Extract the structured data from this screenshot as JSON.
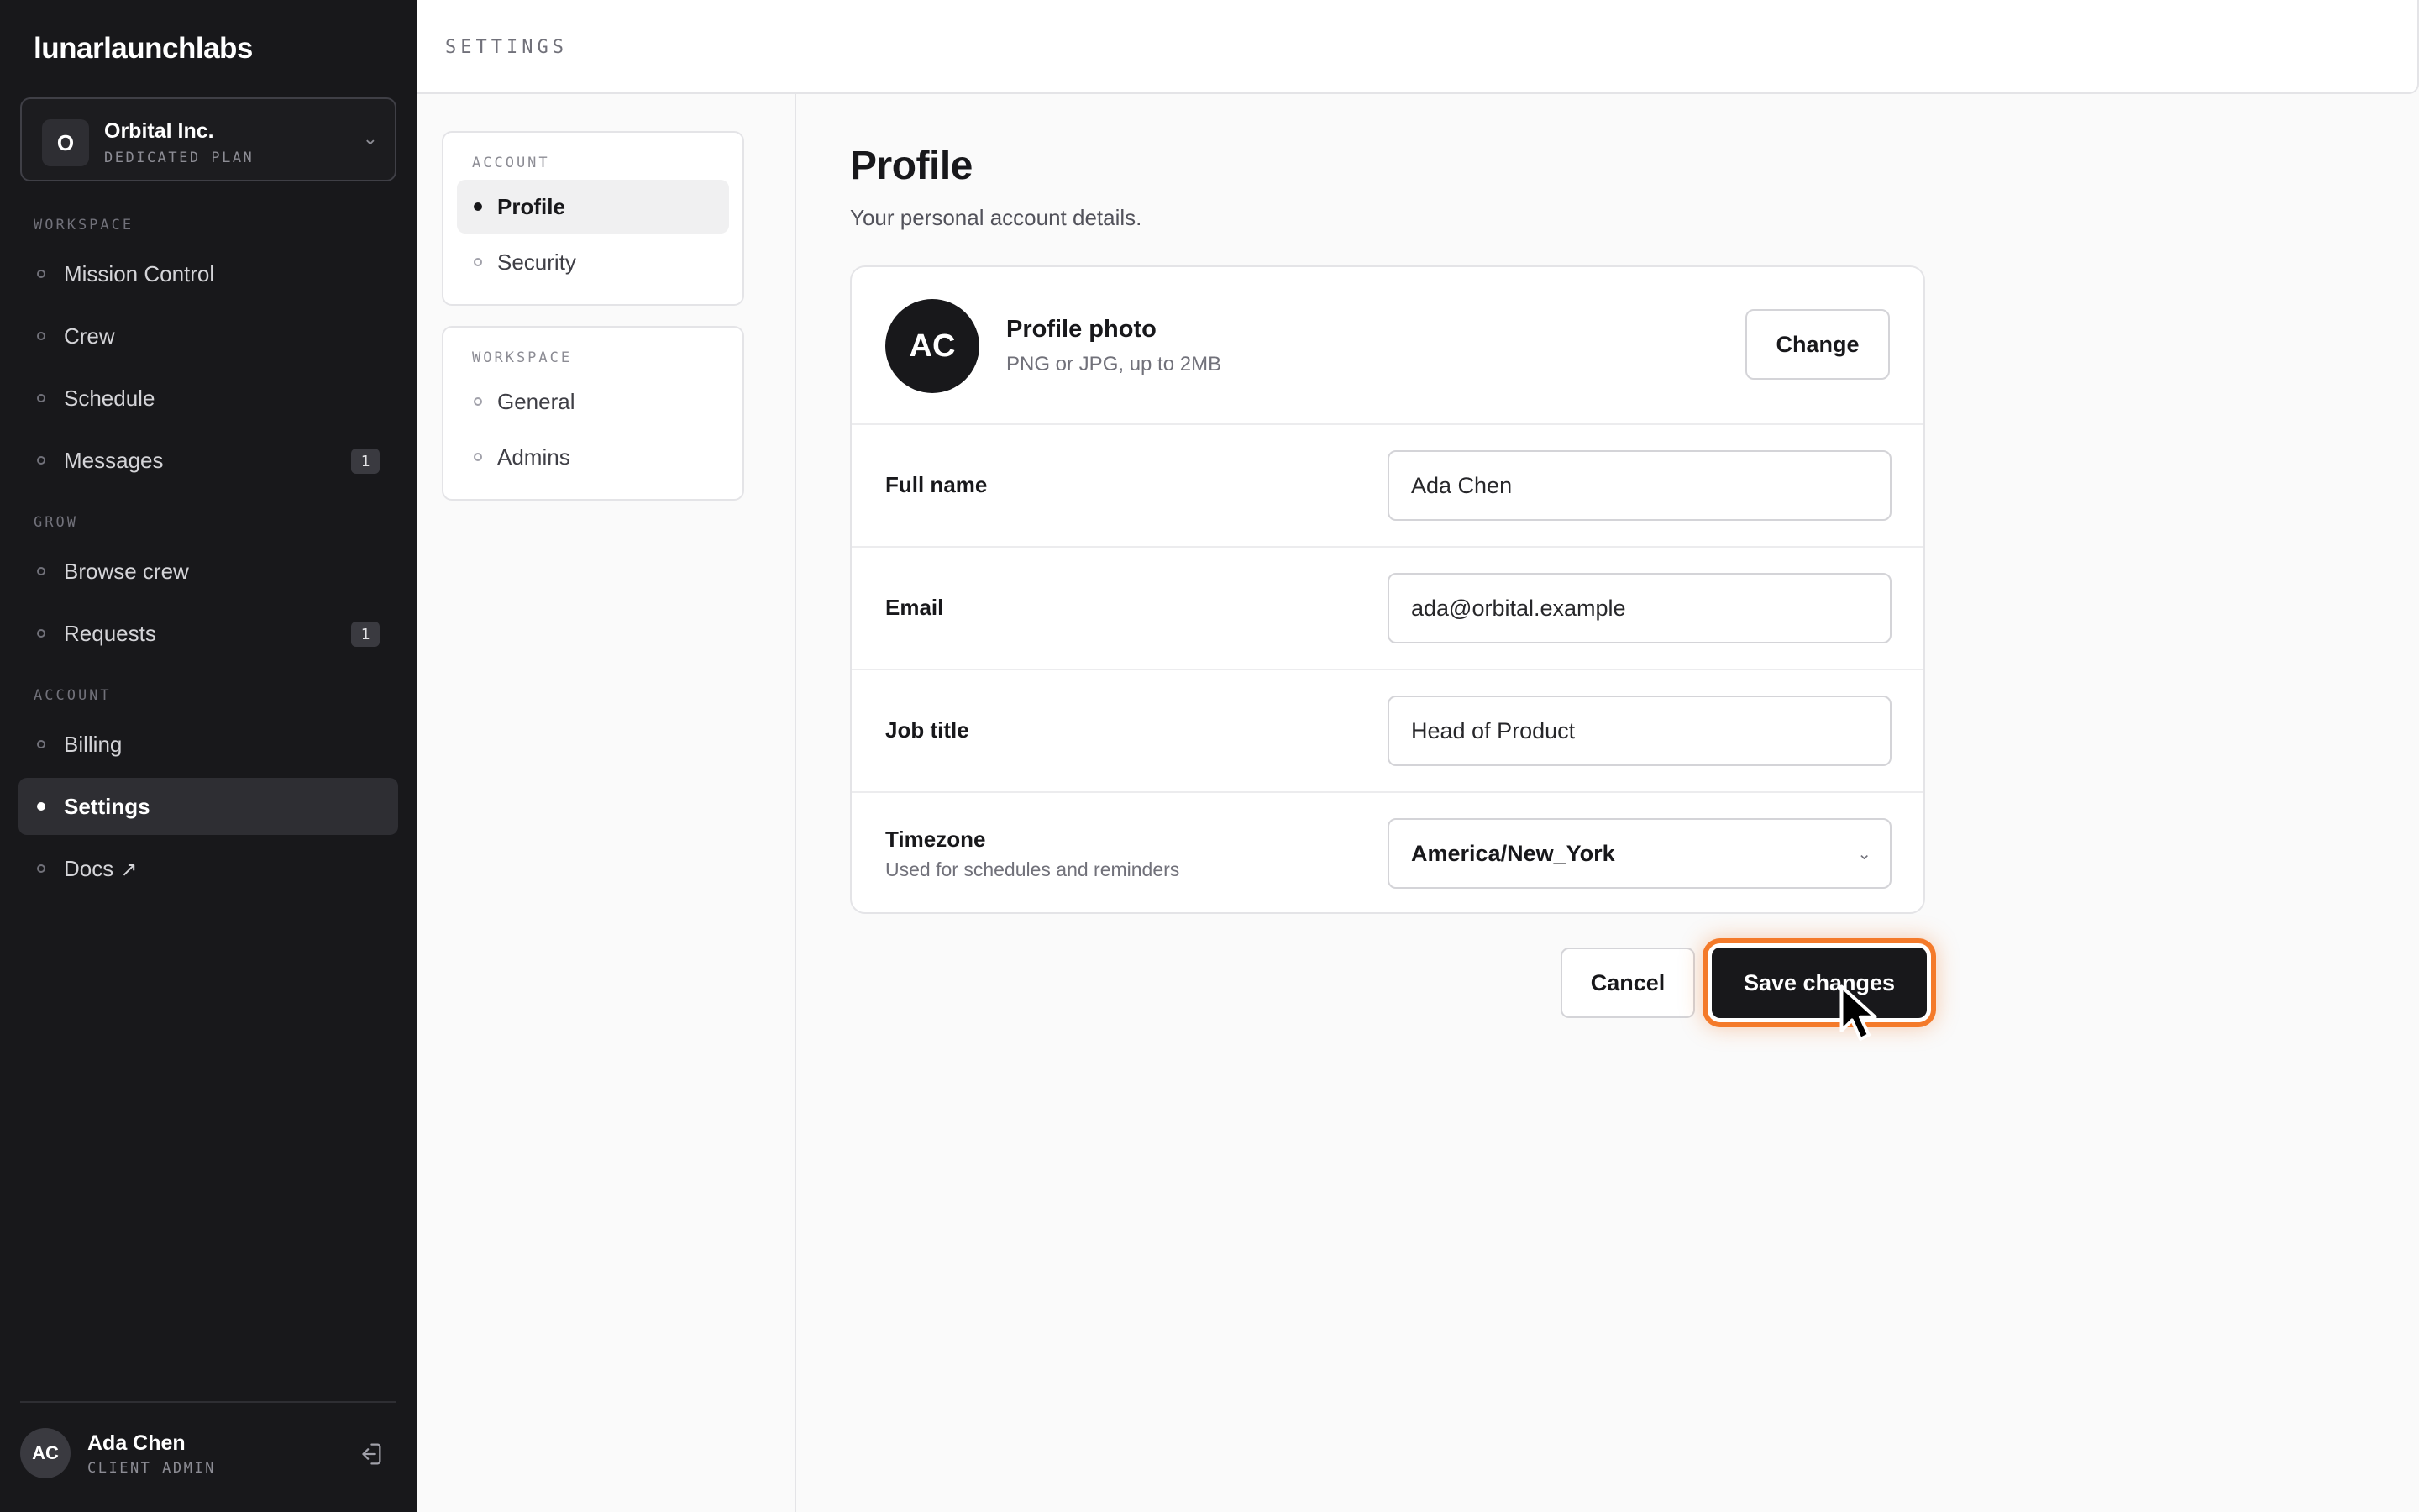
{
  "brand": "lunarlaunchlabs",
  "org": {
    "avatar": "O",
    "name": "Orbital Inc.",
    "plan": "DEDICATED PLAN"
  },
  "sidebar": {
    "sections": [
      {
        "title": "WORKSPACE"
      },
      {
        "title": "GROW"
      },
      {
        "title": "ACCOUNT"
      }
    ],
    "items": [
      {
        "label": "Mission Control"
      },
      {
        "label": "Crew"
      },
      {
        "label": "Schedule"
      },
      {
        "label": "Messages",
        "badge": "1"
      },
      {
        "label": "Browse crew"
      },
      {
        "label": "Requests",
        "badge": "1"
      },
      {
        "label": "Billing"
      },
      {
        "label": "Settings",
        "active": true
      },
      {
        "label": "Docs",
        "icon": "external-link-icon"
      }
    ]
  },
  "user": {
    "initials": "AC",
    "name": "Ada Chen",
    "role": "CLIENT ADMIN",
    "logout_icon": "logout-icon"
  },
  "topbar": {
    "title": "SETTINGS"
  },
  "settings_nav": {
    "account_title": "ACCOUNT",
    "account_items": [
      {
        "label": "Profile",
        "active": true
      },
      {
        "label": "Security"
      }
    ],
    "workspace_title": "WORKSPACE",
    "workspace_items": [
      {
        "label": "General"
      },
      {
        "label": "Admins"
      }
    ]
  },
  "profile": {
    "title": "Profile",
    "subtitle": "Your personal account details.",
    "photo": {
      "initials": "AC",
      "title": "Profile photo",
      "hint": "PNG or JPG, up to 2MB",
      "change_label": "Change"
    },
    "fields": {
      "full_name": {
        "label": "Full name",
        "value": "Ada Chen"
      },
      "email": {
        "label": "Email",
        "value": "ada@orbital.example"
      },
      "job_title": {
        "label": "Job title",
        "value": "Head of Product"
      },
      "timezone": {
        "label": "Timezone",
        "hint": "Used for schedules and reminders",
        "value": "America/New_York"
      }
    },
    "cancel_label": "Cancel",
    "save_label": "Save changes"
  },
  "colors": {
    "sidebar_bg": "#18181b",
    "accent_focus": "#f47a2a",
    "primary_button": "#18181b"
  }
}
